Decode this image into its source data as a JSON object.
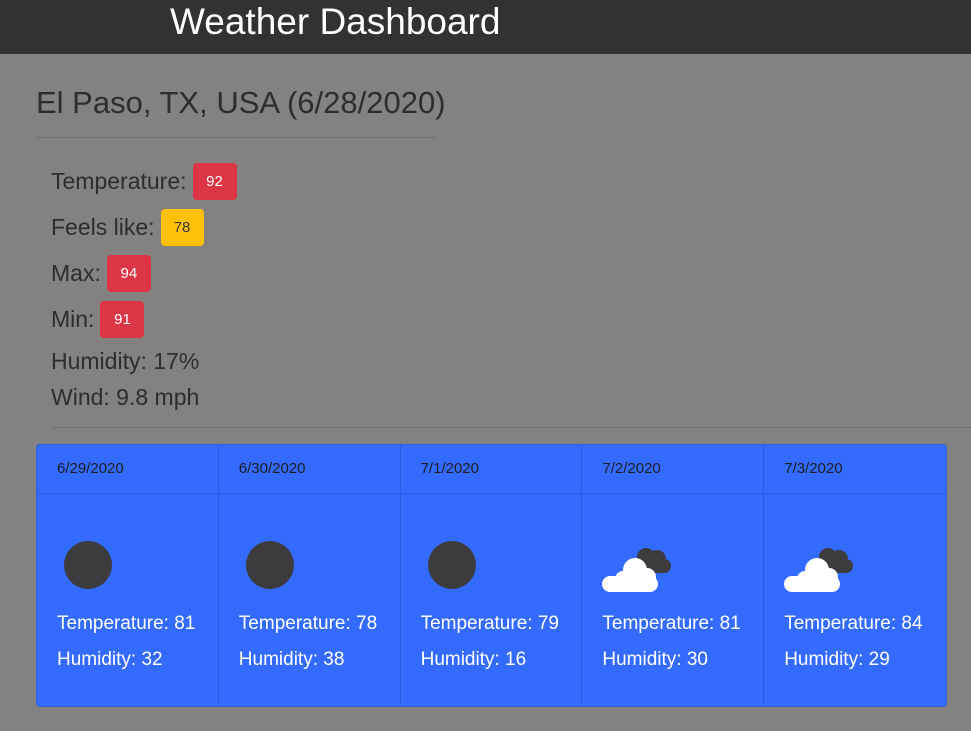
{
  "header": {
    "title": "Weather Dashboard"
  },
  "current": {
    "city_title": "El Paso, TX, USA (6/28/2020)",
    "temperature_label": "Temperature:",
    "temperature": "92",
    "feels_like_label": "Feels like:",
    "feels_like": "78",
    "max_label": "Max:",
    "max": "94",
    "min_label": "Min:",
    "min": "91",
    "humidity": "Humidity: 17%",
    "wind": "Wind: 9.8 mph"
  },
  "colors": {
    "hot": "#dc3545",
    "warm": "#ffc107",
    "forecast_bg": "#346bff",
    "topbar": "#323232"
  },
  "forecast": [
    {
      "date": "6/29/2020",
      "icon": "clear-night-icon",
      "temp": "Temperature: 81",
      "humidity": "Humidity: 32"
    },
    {
      "date": "6/30/2020",
      "icon": "clear-night-icon",
      "temp": "Temperature: 78",
      "humidity": "Humidity: 38"
    },
    {
      "date": "7/1/2020",
      "icon": "clear-night-icon",
      "temp": "Temperature: 79",
      "humidity": "Humidity: 16"
    },
    {
      "date": "7/2/2020",
      "icon": "broken-clouds-icon",
      "temp": "Temperature: 81",
      "humidity": "Humidity: 30"
    },
    {
      "date": "7/3/2020",
      "icon": "broken-clouds-icon",
      "temp": "Temperature: 84",
      "humidity": "Humidity: 29"
    }
  ]
}
